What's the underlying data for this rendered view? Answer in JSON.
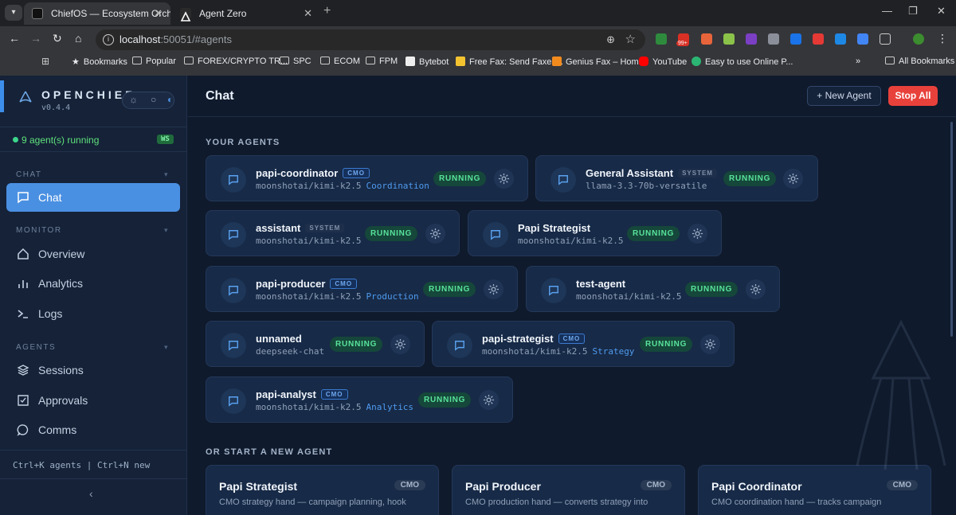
{
  "browser": {
    "tabs": [
      {
        "title": "ChiefOS — Ecosystem Orchestr",
        "active": true
      },
      {
        "title": "Agent Zero",
        "active": false
      }
    ],
    "url_host": "localhost",
    "url_rest": ":50051/#agents",
    "bookmarks": [
      "Bookmarks",
      "Popular",
      "FOREX/CRYPTO TR...",
      "SPC",
      "ECOM",
      "FPM",
      "Bytebot",
      "Free Fax: Send Faxes...",
      "Genius Fax – Home",
      "YouTube",
      "Easy to use Online P...",
      "All Bookmarks"
    ],
    "ext_badge": "99+"
  },
  "sidebar": {
    "brand": "OPENCHIEF",
    "version": "v0.4.4",
    "status": "9 agent(s) running",
    "ws": "WS",
    "sections": {
      "chat": "CHAT",
      "monitor": "MONITOR",
      "agents": "AGENTS"
    },
    "items": {
      "chat": "Chat",
      "overview": "Overview",
      "analytics": "Analytics",
      "logs": "Logs",
      "sessions": "Sessions",
      "approvals": "Approvals",
      "comms": "Comms"
    },
    "footer": "Ctrl+K agents | Ctrl+N new"
  },
  "main": {
    "title": "Chat",
    "new_agent": "+ New Agent",
    "stop_all": "Stop All",
    "your_agents": "YOUR AGENTS",
    "start_new": "OR START A NEW AGENT"
  },
  "agents": [
    {
      "name": "papi-coordinator",
      "tag": "CMO",
      "model": "moonshotai/kimi-k2.5",
      "role": "Coordination",
      "status": "RUNNING"
    },
    {
      "name": "General Assistant",
      "tag": "SYSTEM",
      "model": "llama-3.3-70b-versatile",
      "role": "",
      "status": "RUNNING"
    },
    {
      "name": "assistant",
      "tag": "SYSTEM",
      "model": "moonshotai/kimi-k2.5",
      "role": "",
      "status": "RUNNING"
    },
    {
      "name": "Papi Strategist",
      "tag": "",
      "model": "moonshotai/kimi-k2.5",
      "role": "",
      "status": "RUNNING"
    },
    {
      "name": "papi-producer",
      "tag": "CMO",
      "model": "moonshotai/kimi-k2.5",
      "role": "Production",
      "status": "RUNNING"
    },
    {
      "name": "test-agent",
      "tag": "",
      "model": "moonshotai/kimi-k2.5",
      "role": "",
      "status": "RUNNING"
    },
    {
      "name": "unnamed",
      "tag": "",
      "model": "deepseek-chat",
      "role": "",
      "status": "RUNNING"
    },
    {
      "name": "papi-strategist",
      "tag": "CMO",
      "model": "moonshotai/kimi-k2.5",
      "role": "Strategy",
      "status": "RUNNING"
    },
    {
      "name": "papi-analyst",
      "tag": "CMO",
      "model": "moonshotai/kimi-k2.5",
      "role": "Analytics",
      "status": "RUNNING"
    }
  ],
  "templates": [
    {
      "title": "Papi Strategist",
      "badge": "CMO",
      "desc": "CMO strategy hand — campaign planning, hook"
    },
    {
      "title": "Papi Producer",
      "badge": "CMO",
      "desc": "CMO production hand — converts strategy into"
    },
    {
      "title": "Papi Coordinator",
      "badge": "CMO",
      "desc": "CMO coordination hand — tracks campaign"
    }
  ]
}
